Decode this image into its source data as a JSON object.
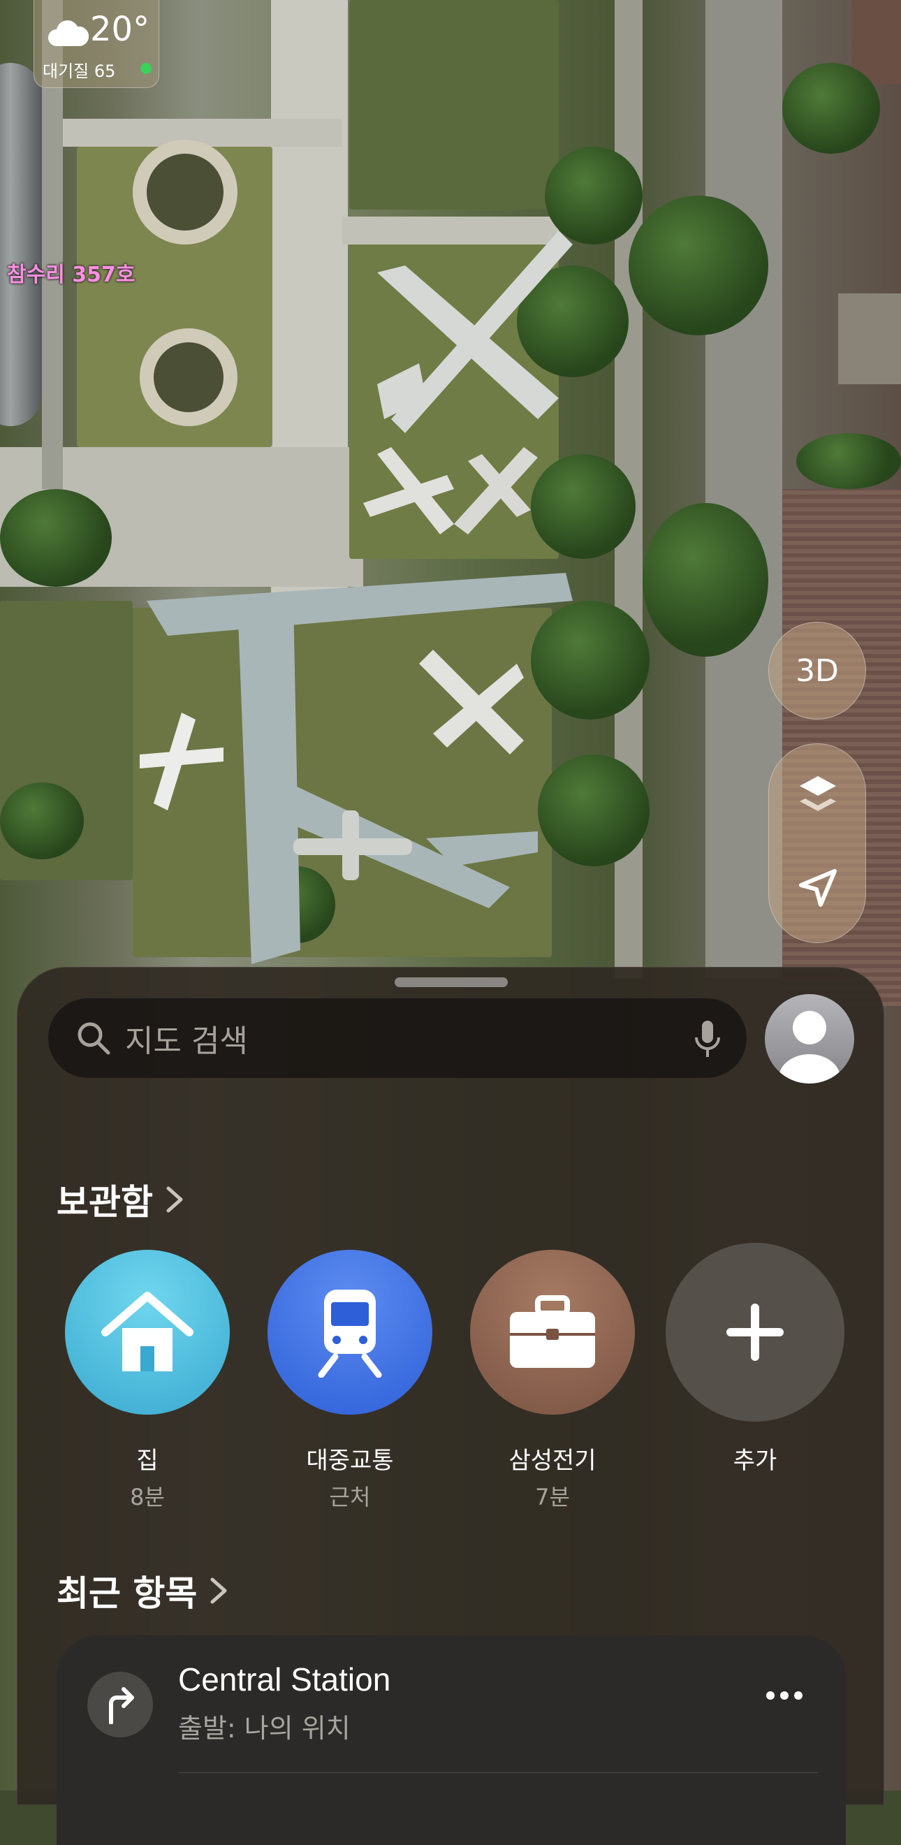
{
  "weather": {
    "temperature": "20°",
    "air_quality": "대기질 65",
    "icon": "cloud-icon",
    "air_quality_color": "#3bd15a"
  },
  "map": {
    "poi_label": "참수리 357호"
  },
  "controls": {
    "view_3d_label": "3D",
    "layers_icon": "layers-icon",
    "location_icon": "location-arrow-icon"
  },
  "search": {
    "placeholder": "지도 검색",
    "mic_icon": "microphone-icon"
  },
  "library": {
    "title": "보관함",
    "items": [
      {
        "name": "집",
        "sub": "8분",
        "icon": "house-icon",
        "color": "#4cc1e0"
      },
      {
        "name": "대중교통",
        "sub": "근처",
        "icon": "train-icon",
        "color": "#3c72e6"
      },
      {
        "name": "삼성전기",
        "sub": "7분",
        "icon": "briefcase-icon",
        "color": "#8a5f4a"
      },
      {
        "name": "추가",
        "sub": "",
        "icon": "plus-icon",
        "color": "#4a4845"
      }
    ]
  },
  "recents": {
    "title": "최근 항목",
    "items": [
      {
        "title": "Central Station",
        "subtitle": "출발: 나의 위치",
        "icon": "turn-right-arrow-icon"
      }
    ]
  }
}
